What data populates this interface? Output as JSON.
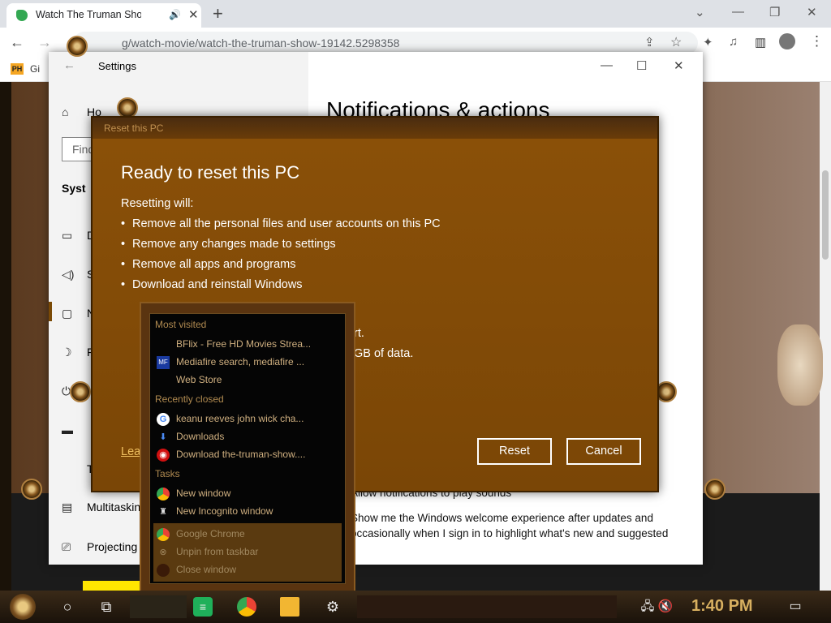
{
  "browser": {
    "tab_title": "Watch The Truman Show",
    "url": "g/watch-movie/watch-the-truman-show-19142.5298358",
    "bookmark_label": "Gi"
  },
  "settings": {
    "window_title": "Settings",
    "search_placeholder": "Find",
    "page_heading": "Notifications & actions",
    "sidebar_partial": [
      "Ho",
      "Syst",
      "D",
      "S",
      "N",
      "F",
      "N",
      "T"
    ],
    "sidebar_items": [
      "Multitasking",
      "Projecting"
    ],
    "options": [
      "Allow notifications to play sounds",
      "Show me the Windows welcome experience after updates and occasionally when I sign in to highlight what's new and suggested"
    ]
  },
  "reset_dialog": {
    "header": "Reset this PC",
    "title": "Ready to reset this PC",
    "intro": "Resetting will:",
    "bullets": [
      "Remove all the personal files and user accounts on this PC",
      "Remove any changes made to settings",
      "Remove all apps and programs",
      "Download and reinstall Windows"
    ],
    "partial_lines": [
      "rt.",
      "GB of data."
    ],
    "learn_more": "Lea",
    "reset_label": "Reset",
    "cancel_label": "Cancel"
  },
  "jump_list": {
    "most_visited_header": "Most visited",
    "most_visited": [
      "BFlix - Free HD Movies Strea...",
      "Mediafire search, mediafire ...",
      "Web Store"
    ],
    "recently_closed_header": "Recently closed",
    "recently_closed": [
      "keanu reeves john wick cha...",
      "Downloads",
      "Download the-truman-show...."
    ],
    "tasks_header": "Tasks",
    "tasks": [
      "New window",
      "New Incognito window"
    ],
    "pinned": [
      "Google Chrome",
      "Unpin from taskbar",
      "Close window"
    ]
  },
  "taskbar": {
    "clock": "1:40 PM"
  },
  "colors": {
    "dialog_bg": "#7a4a06",
    "accent_gold": "#d8b060"
  }
}
